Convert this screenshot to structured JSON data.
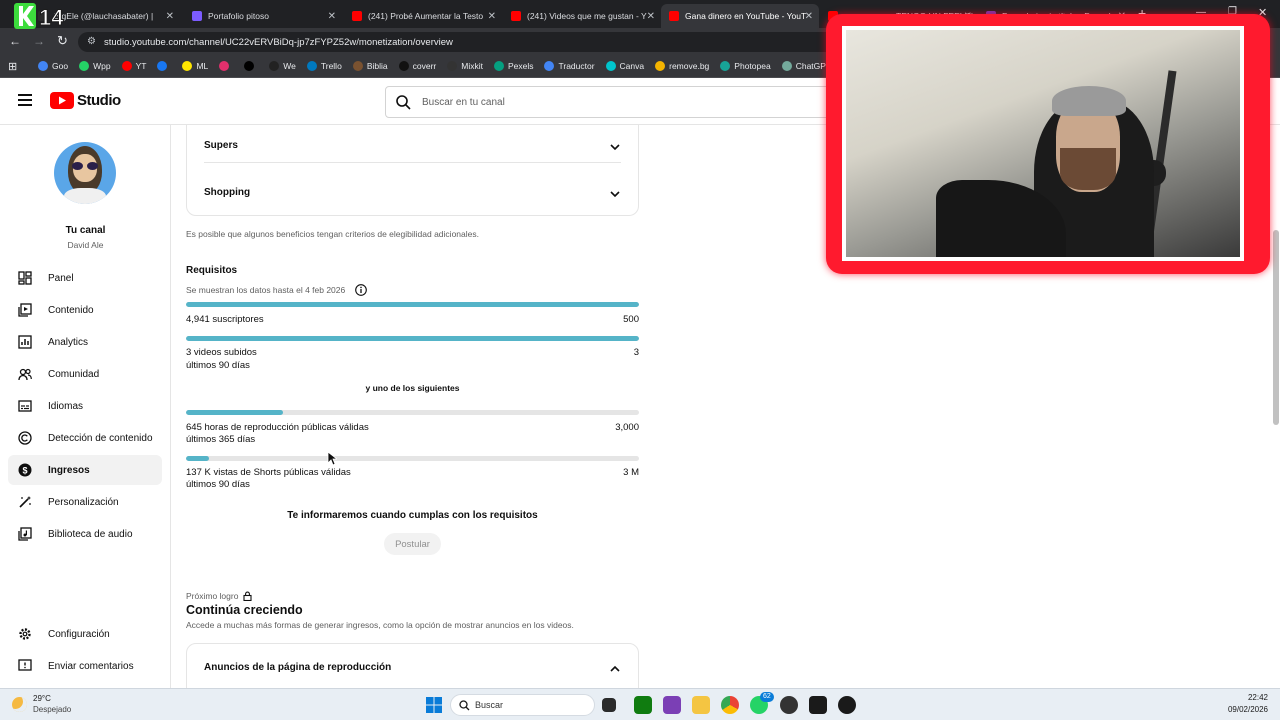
{
  "browser": {
    "tabs": [
      {
        "label": "BigEle (@lauchasabater) |",
        "color": "#2b2b2b"
      },
      {
        "label": "Portafolio pitoso",
        "color": "#7c5cff"
      },
      {
        "label": "(241) Probé Aumentar la Testo",
        "color": "#ff0000"
      },
      {
        "label": "(241) Videos que me gustan - Y",
        "color": "#ff0000"
      },
      {
        "label": "Gana dinero en YouTube - YouT",
        "color": "#ff0000"
      },
      {
        "label": "TENGO UN FEELIN",
        "color": "#ff0000"
      },
      {
        "label": "Formulario sin título - Formula",
        "color": "#673ab7"
      }
    ],
    "url": "studio.youtube.com/channel/UC22vERVBiDq-jp7zFYPZ52w/monetization/overview",
    "bookmarks": [
      {
        "label": "Goo",
        "color": "#4285f4"
      },
      {
        "label": "Wpp",
        "color": "#25d366"
      },
      {
        "label": "YT",
        "color": "#ff0000"
      },
      {
        "label": "",
        "color": "#1877f2"
      },
      {
        "label": "ML",
        "color": "#ffe600"
      },
      {
        "label": "",
        "color": "#e1306c"
      },
      {
        "label": "",
        "color": "#000000"
      },
      {
        "label": "We",
        "color": "#222222"
      },
      {
        "label": "Trello",
        "color": "#0079bf"
      },
      {
        "label": "Biblia",
        "color": "#7a5230"
      },
      {
        "label": "coverr",
        "color": "#111111"
      },
      {
        "label": "Mixkit",
        "color": "#333333"
      },
      {
        "label": "Pexels",
        "color": "#05a081"
      },
      {
        "label": "Traductor",
        "color": "#4285f4"
      },
      {
        "label": "Canva",
        "color": "#00c4cc"
      },
      {
        "label": "remove.bg",
        "color": "#f4b400"
      },
      {
        "label": "Photopea",
        "color": "#18a497"
      },
      {
        "label": "ChatGPT",
        "color": "#74aa9c"
      }
    ]
  },
  "header": {
    "brand": "Studio",
    "search_placeholder": "Buscar en tu canal"
  },
  "sidebar": {
    "channel_title": "Tu canal",
    "channel_name": "David Ale",
    "items": [
      {
        "label": "Panel",
        "icon": "dashboard-icon"
      },
      {
        "label": "Contenido",
        "icon": "content-icon"
      },
      {
        "label": "Analytics",
        "icon": "analytics-icon"
      },
      {
        "label": "Comunidad",
        "icon": "community-icon"
      },
      {
        "label": "Idiomas",
        "icon": "subtitles-icon"
      },
      {
        "label": "Detección de contenido",
        "icon": "copyright-icon"
      },
      {
        "label": "Ingresos",
        "icon": "dollar-icon"
      },
      {
        "label": "Personalización",
        "icon": "magic-wand-icon"
      },
      {
        "label": "Biblioteca de audio",
        "icon": "audio-library-icon"
      }
    ],
    "bottom": [
      {
        "label": "Configuración",
        "icon": "gear-icon"
      },
      {
        "label": "Enviar comentarios",
        "icon": "feedback-icon"
      }
    ]
  },
  "main": {
    "benefits": [
      "Supers",
      "Shopping"
    ],
    "eligibility_note": "Es posible que algunos beneficios tengan criterios de elegibilidad adicionales.",
    "requirements_title": "Requisitos",
    "data_note": "Se muestran los datos hasta el 4 feb 2026",
    "req1": {
      "label": "4,941 suscriptores",
      "target": "500",
      "progress": 1.0
    },
    "req2": {
      "label": "3 videos subidos",
      "sub": "últimos 90 días",
      "target": "3",
      "progress": 1.0
    },
    "either": "y uno de los siguientes",
    "req3": {
      "label": "645 horas de reproducción públicas válidas",
      "sub": "últimos 365 días",
      "target": "3,000",
      "progress": 0.215
    },
    "req4": {
      "label": "137 K vistas de Shorts públicas válidas",
      "sub": "últimos 90 días",
      "target": "3 M",
      "progress": 0.05
    },
    "notify": "Te informaremos cuando cumplas con los requisitos",
    "apply_button": "Postular",
    "next_label": "Próximo logro",
    "next_title": "Continúa creciendo",
    "next_desc": "Accede a muchas más formas de generar ingresos, como la opción de mostrar anuncios en los videos.",
    "ads_card": "Anuncios de la página de reproducción"
  },
  "taskbar": {
    "temp": "29°C",
    "weather": "Despejado",
    "search": "Buscar",
    "time": "22:42",
    "date": "09/02/2026",
    "badge": "62"
  },
  "overlay": {
    "logo_text": "14",
    "webcam_caption": ""
  }
}
